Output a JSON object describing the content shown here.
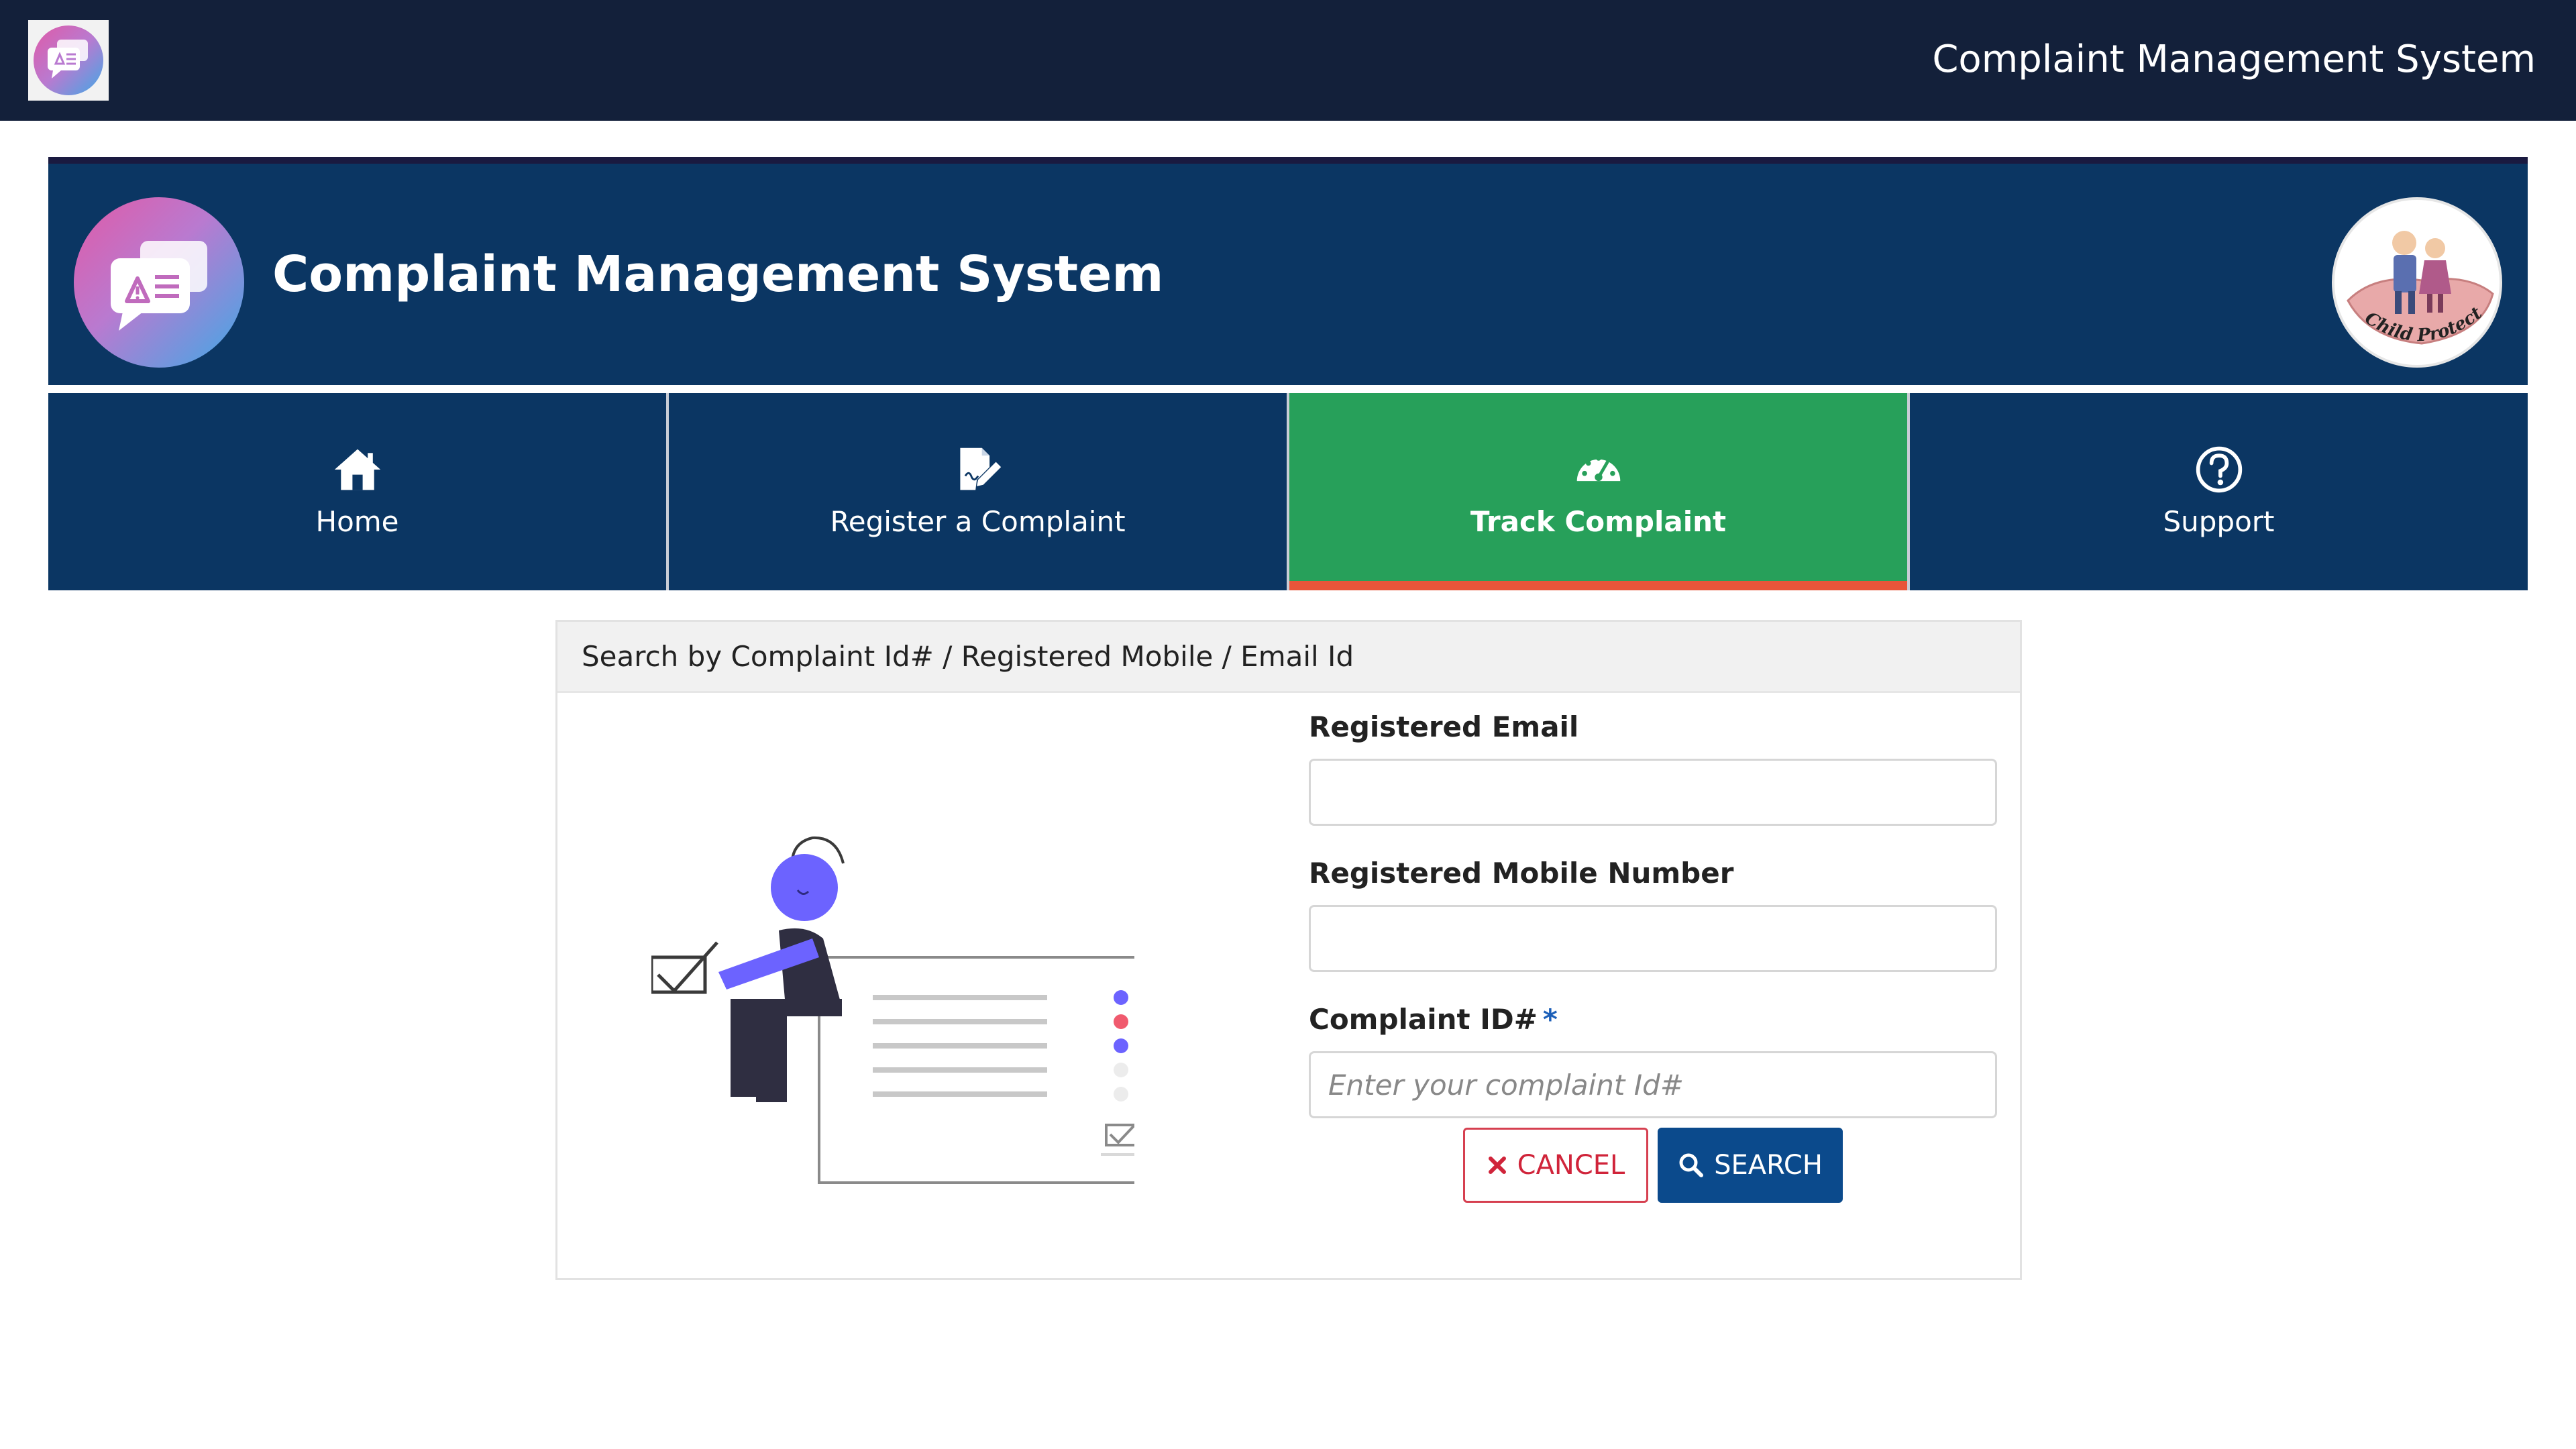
{
  "topbar": {
    "title": "Complaint Management System",
    "logo_icon": "chat-warning-icon"
  },
  "banner": {
    "title": "Complaint Management System",
    "logo_icon": "chat-warning-icon",
    "emblem_text": "Child Protection"
  },
  "nav": {
    "items": [
      {
        "label": "Home",
        "icon": "home-icon",
        "active": false
      },
      {
        "label": "Register a Complaint",
        "icon": "edit-document-icon",
        "active": false
      },
      {
        "label": "Track Complaint",
        "icon": "speedometer-icon",
        "active": true
      },
      {
        "label": "Support",
        "icon": "question-circle-icon",
        "active": false
      }
    ]
  },
  "search_card": {
    "header": "Search by Complaint Id# / Registered Mobile / Email Id",
    "fields": {
      "email": {
        "label": "Registered Email",
        "value": "",
        "placeholder": ""
      },
      "mobile": {
        "label": "Registered Mobile Number",
        "value": "",
        "placeholder": ""
      },
      "complaint_id": {
        "label": "Complaint ID#",
        "required_mark": "*",
        "value": "",
        "placeholder": "Enter your complaint Id#"
      }
    },
    "buttons": {
      "cancel": {
        "label": "CANCEL",
        "icon": "x-icon"
      },
      "search": {
        "label": "SEARCH",
        "icon": "search-icon"
      }
    }
  },
  "colors": {
    "topbar_bg": "#13203a",
    "banner_bg": "#0b3663",
    "nav_active_bg": "#27a05a",
    "nav_active_underline": "#e8553a",
    "cancel_red": "#d0243a",
    "search_blue": "#0b4a8c"
  }
}
